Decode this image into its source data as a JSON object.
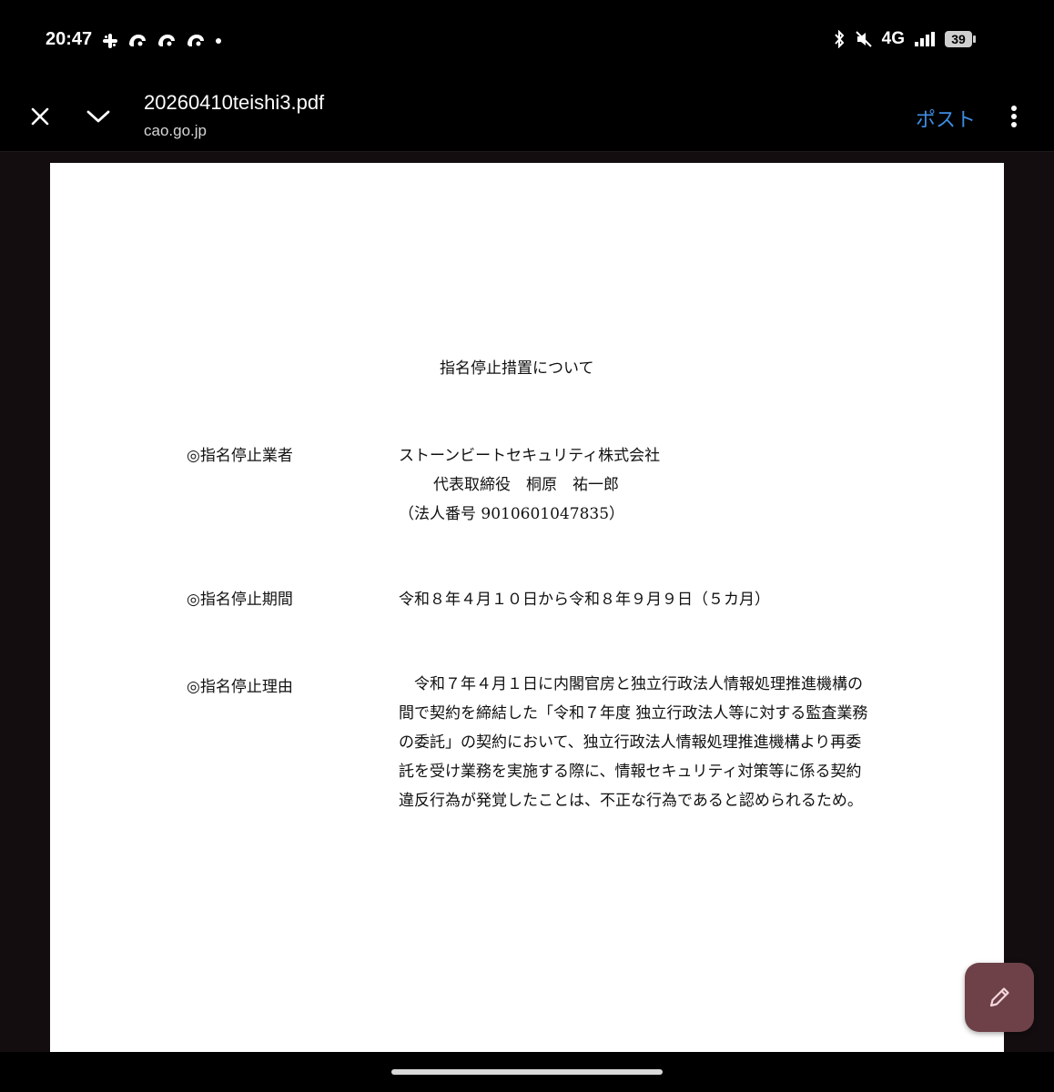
{
  "status_bar": {
    "time": "20:47",
    "notification_icons": [
      "slack-icon",
      "bird-icon",
      "bird-icon",
      "bird-icon",
      "dot-icon"
    ],
    "network": "4G",
    "battery_level": "39"
  },
  "app_bar": {
    "file_name": "20260410teishi3.pdf",
    "domain": "cao.go.jp",
    "post_label": "ポスト"
  },
  "document": {
    "title": "指名停止措置について",
    "contractor": {
      "label": "◎指名停止業者",
      "company": "ストーンビートセキュリティ株式会社",
      "representative": "代表取締役　桐原　祐一郎",
      "corporate_number": "（法人番号 9010601047835）"
    },
    "period": {
      "label": "◎指名停止期間",
      "value": "令和８年４月１０日から令和８年９月９日（５カ月）"
    },
    "reason": {
      "label": "◎指名停止理由",
      "text": "　令和７年４月１日に内閣官房と独立行政法人情報処理推進機構の間で契約を締結した「令和７年度 独立行政法人等に対する監査業務の委託」の契約において、独立行政法人情報処理推進機構より再委託を受け業務を実施する際に、情報セキュリティ対策等に係る契約違反行為が発覚したことは、不正な行為であると認められるため。"
    }
  },
  "colors": {
    "accent": "#3e8de3",
    "fab": "#6e4148",
    "viewer_background": "#130d0f"
  }
}
